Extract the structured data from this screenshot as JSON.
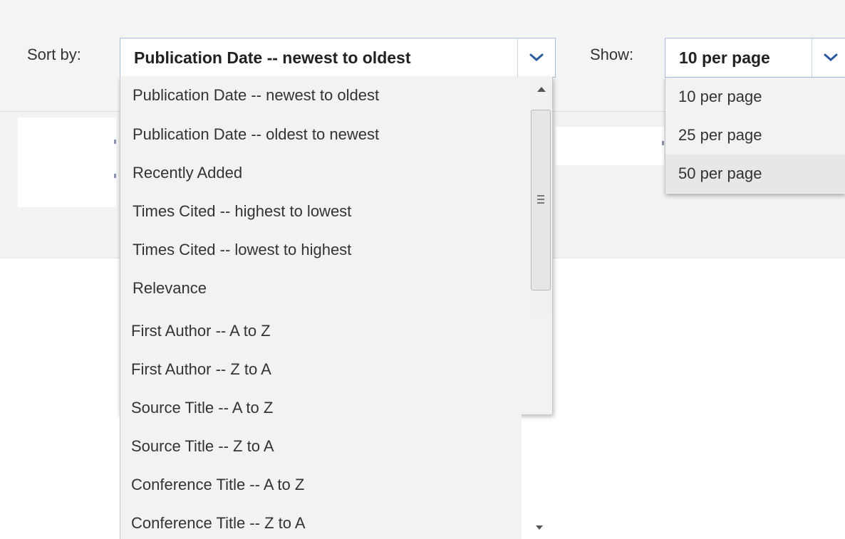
{
  "sort": {
    "label": "Sort by:",
    "selected": "Publication Date -- newest to oldest",
    "options": [
      "Publication Date -- newest to oldest",
      "Publication Date -- oldest to newest",
      "Recently Added",
      "Times Cited -- highest to lowest",
      "Times Cited -- lowest to highest",
      "Relevance",
      "First Author -- A to Z",
      "First Author -- Z to A",
      "Source Title -- A to Z",
      "Source Title -- Z to A",
      "Conference Title -- A to Z",
      "Conference Title -- Z to A"
    ]
  },
  "show": {
    "label": "Show:",
    "selected": "10 per page",
    "options": [
      "10 per page",
      "25 per page",
      "50 per page"
    ],
    "hovered": "50 per page"
  },
  "colors": {
    "accent": "#2b5aa0",
    "border": "#a9bfe0",
    "menu_bg": "#f2f2f2",
    "hover_bg": "#e7e7e7"
  },
  "icons": {
    "dropdown": "chevron-down-icon",
    "scroll_up": "scroll-up-arrow-icon",
    "scroll_down": "scroll-down-arrow-icon",
    "grip": "scroll-grip-icon"
  }
}
